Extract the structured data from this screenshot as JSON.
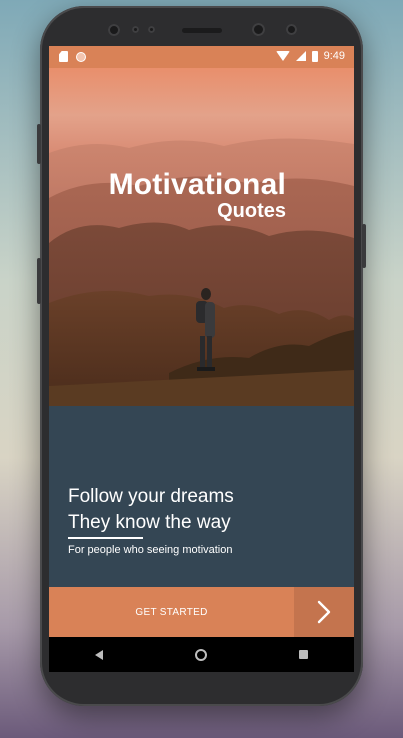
{
  "status_bar": {
    "time": "9:49",
    "icons": [
      "sim-card-icon",
      "notification-dot-icon",
      "wifi-icon",
      "signal-icon",
      "battery-icon"
    ]
  },
  "hero": {
    "title": "Motivational",
    "subtitle": "Quotes"
  },
  "panel": {
    "line1": "Follow your dreams",
    "line2": "They know the way",
    "caption": "For people who seeing motivation"
  },
  "action": {
    "primary_label": "GET STARTED",
    "next_icon": "chevron-right-icon"
  },
  "nav_bar": {
    "icons": [
      "back-icon",
      "home-icon",
      "recents-icon"
    ]
  },
  "colors": {
    "accent": "#d98257",
    "accent_dark": "#c4744e",
    "panel": "#344654"
  }
}
